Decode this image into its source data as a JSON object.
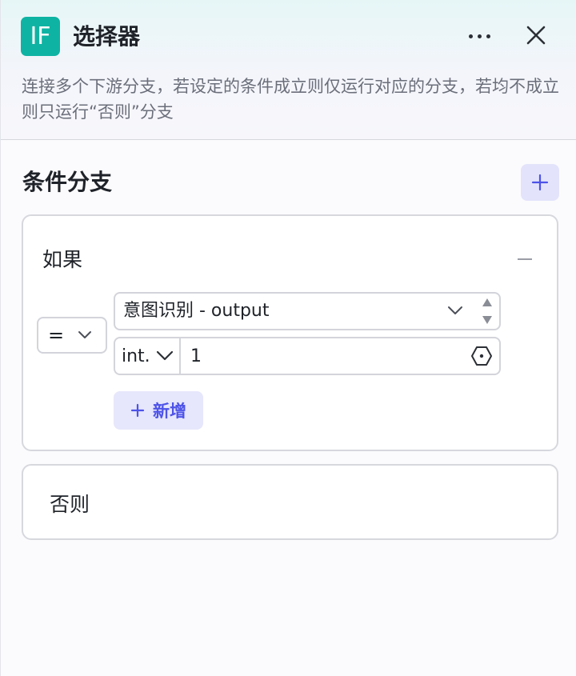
{
  "header": {
    "logo_text": "IF",
    "title": "选择器",
    "description": "连接多个下游分支，若设定的条件成立则仅运行对应的分支，若均不成立则只运行“否则”分支",
    "icons": {
      "more": "more-horizontal-icon",
      "close": "close-icon"
    }
  },
  "conditions": {
    "title": "条件分支",
    "add_icon": "plus-icon",
    "if_branch": {
      "label": "如果",
      "remove_icon": "minus-icon",
      "condition": {
        "operator": "=",
        "variable": "意图识别 - output",
        "value_type": "int.",
        "value": "1"
      },
      "add_label": "新增"
    },
    "else_branch": {
      "label": "否则"
    }
  },
  "colors": {
    "brand_teal": "#0fb3a3",
    "accent_purple": "#4d53e8",
    "accent_bg": "#e6e6fc",
    "border": "#d3d4db"
  }
}
